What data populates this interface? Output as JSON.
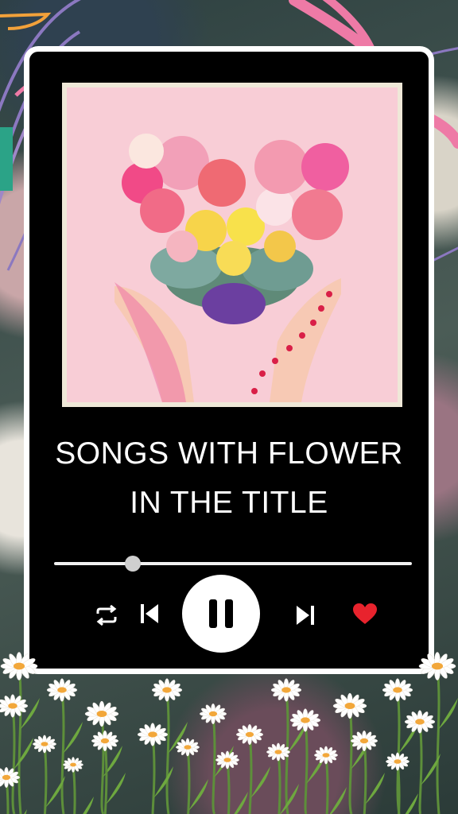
{
  "player": {
    "title_line1": "SONGS WITH FLOWER",
    "title_line2": "IN THE TITLE",
    "progress_fraction": 0.22,
    "liked": true
  },
  "controls": {
    "repeat_icon": "repeat-icon",
    "previous_icon": "skip-previous-icon",
    "play_pause_icon": "pause-icon",
    "next_icon": "skip-next-icon",
    "like_icon": "heart-icon"
  },
  "colors": {
    "panel": "#000000",
    "frame": "#ffffff",
    "art_background": "#f8cdd6",
    "heart": "#e8232d",
    "decor_pink": "#ee7aa6",
    "decor_purple": "#7f6fb2"
  }
}
